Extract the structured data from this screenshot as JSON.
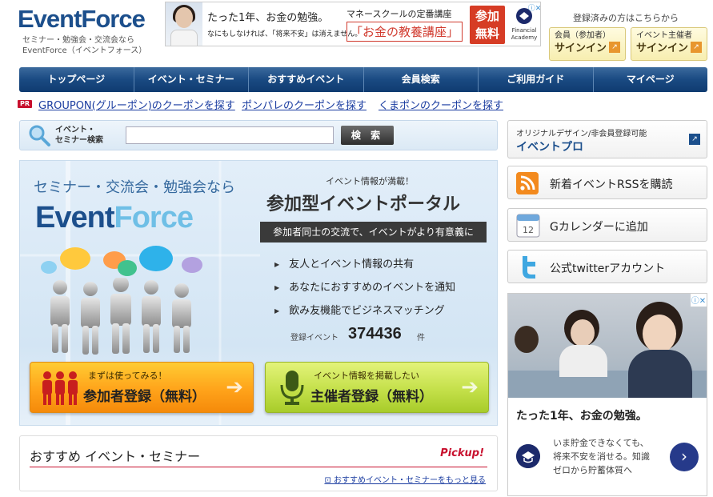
{
  "logo": {
    "text": "EventForce",
    "tagline_1": "セミナー・勉強会・交流会なら",
    "tagline_2": "EventForce（イベントフォース）"
  },
  "top_ad": {
    "line1": "たった1年、お金の勉強。",
    "line2": "なにもしなければ、「将来不安」は消えません。",
    "line3": "マネースクールの定番講座",
    "line4": "「お金の教養講座」",
    "cta": "参加\n無料",
    "brand": "Financial Academy"
  },
  "login": {
    "caption": "登録済みの方はこちらから",
    "member_role": "会員（参加者）",
    "member_action": "サインイン",
    "host_role": "イベント主催者",
    "host_action": "サインイン"
  },
  "nav": [
    "トップページ",
    "イベント・セミナー",
    "おすすめイベント",
    "会員検索",
    "ご利用ガイド",
    "マイページ"
  ],
  "pr": {
    "tag": "PR",
    "links": [
      "GROUPON(グルーポン)のクーポンを探す",
      "ポンパレのクーポンを探す",
      "くまポンのクーポンを探す"
    ]
  },
  "search": {
    "label_1": "イベント・",
    "label_2": "セミナー検索",
    "value": "",
    "button": "検 索"
  },
  "hero": {
    "tagline": "セミナー・交流会・勉強会なら",
    "logo_a": "Event",
    "logo_b": "Force",
    "sub": "イベント情報が満載！",
    "title": "参加型イベントポータル",
    "band": "参加者同士の交流で、イベントがより有意義に",
    "features": [
      "友人とイベント情報の共有",
      "あなたにおすすめのイベントを通知",
      "飲み友機能でビジネスマッチング"
    ],
    "count_label": "登録イベント",
    "count": "374436",
    "count_unit": "件",
    "reg_participant_small": "まずは使ってみる！",
    "reg_participant_big": "参加者登録（無料）",
    "reg_host_small": "イベント情報を掲載したい",
    "reg_host_big": "主催者登録（無料）"
  },
  "pickup": {
    "title": "おすすめ イベント・セミナー",
    "badge": "Pickup!",
    "more": "おすすめイベント・セミナーをもっと見る"
  },
  "side": {
    "eventpro_sub": "オリジナルデザイン/非会員登録可能",
    "eventpro_title": "イベントプロ",
    "rss": "新着イベントRSSを購読",
    "gcal": "Gカレンダーに追加",
    "twitter": "公式twitterアカウント",
    "cal_day": "12"
  },
  "side_ad": {
    "headline": "たった1年、お金の勉強。",
    "text_1": "いま貯金できなくても、",
    "text_2": "将来不安を消せる。知識",
    "text_3": "ゼロから貯蓄体質へ"
  },
  "colors": {
    "brand_blue": "#1c4f8c",
    "nav_blue": "#1a4a82",
    "orange": "#f58a0a",
    "lime": "#c4e04a",
    "pr_red": "#c8102e"
  }
}
